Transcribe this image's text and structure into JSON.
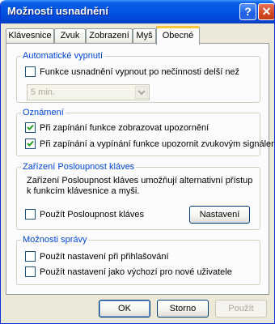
{
  "window": {
    "title": "Možnosti usnadnění",
    "help_label": "?",
    "close_label": "✕"
  },
  "tabs": [
    {
      "label": "Klávesnice",
      "active": false
    },
    {
      "label": "Zvuk",
      "active": false
    },
    {
      "label": "Zobrazení",
      "active": false
    },
    {
      "label": "Myš",
      "active": false
    },
    {
      "label": "Obecné",
      "active": true
    }
  ],
  "auto_off": {
    "title": "Automatické vypnutí",
    "checkbox_label": "Funkce usnadnění vypnout po nečinnosti delší než",
    "checked": false,
    "select_value": "5 min."
  },
  "notify": {
    "title": "Oznámení",
    "items": [
      {
        "label": "Při zapínání funkce zobrazovat upozornění",
        "checked": true
      },
      {
        "label": "Při zapínání a vypínání funkce upozornit zvukovým signálem",
        "checked": true
      }
    ]
  },
  "serial": {
    "title": "Zařízení Posloupnost kláves",
    "desc_line1": "Zařízení Posloupnost kláves umožňují alternativní přístup",
    "desc_line2": "k funkcím klávesnice a myši.",
    "checkbox_label": "Použít Posloupnost kláves",
    "checked": false,
    "settings_button": "Nastavení"
  },
  "admin": {
    "title": "Možnosti správy",
    "items": [
      {
        "label": "Použít nastavení při přihlašování",
        "checked": false
      },
      {
        "label": "Použít nastavení jako výchozí pro nové uživatele",
        "checked": false
      }
    ]
  },
  "buttons": {
    "ok": "OK",
    "cancel": "Storno",
    "apply": "Použít"
  }
}
